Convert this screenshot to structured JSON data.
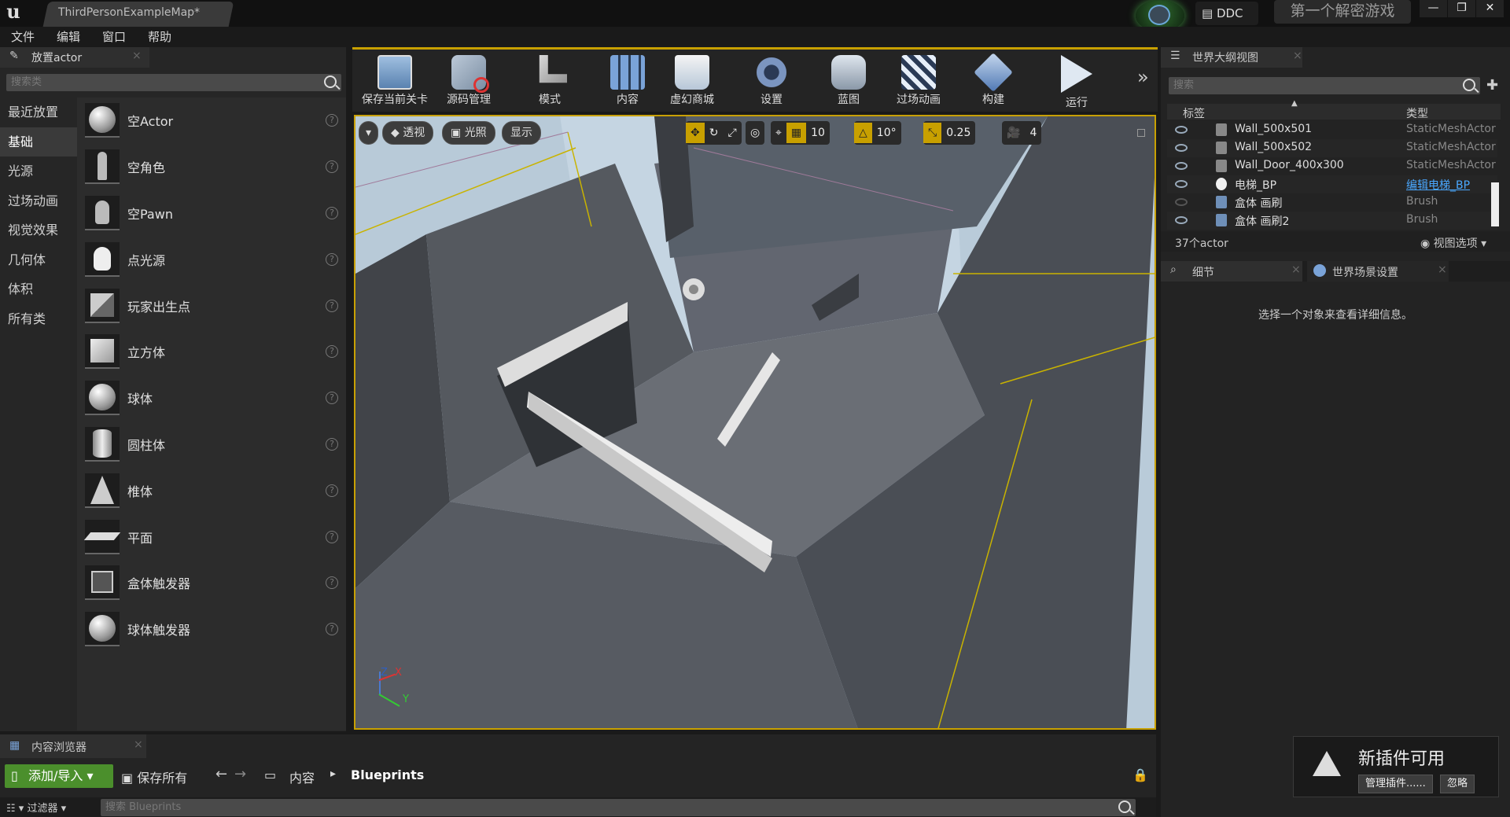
{
  "titlebar": {
    "doc_tab": "ThirdPersonExampleMap*",
    "ddc": "DDC",
    "project_name": "第一个解密游戏",
    "win_minimize": "—",
    "win_restore": "❐",
    "win_close": "✕"
  },
  "menu": [
    "文件",
    "编辑",
    "窗口",
    "帮助"
  ],
  "place_panel": {
    "tab_label": "放置actor",
    "search_placeholder": "搜索类",
    "categories": [
      "最近放置",
      "基础",
      "光源",
      "过场动画",
      "视觉效果",
      "几何体",
      "体积",
      "所有类"
    ],
    "active_category": "基础",
    "items": [
      {
        "label": "空Actor",
        "icon": "empty-actor-icon"
      },
      {
        "label": "空角色",
        "icon": "character-icon"
      },
      {
        "label": "空Pawn",
        "icon": "pawn-icon"
      },
      {
        "label": "点光源",
        "icon": "point-light-icon"
      },
      {
        "label": "玩家出生点",
        "icon": "player-start-icon"
      },
      {
        "label": "立方体",
        "icon": "cube-icon"
      },
      {
        "label": "球体",
        "icon": "sphere-icon"
      },
      {
        "label": "圆柱体",
        "icon": "cylinder-icon"
      },
      {
        "label": "椎体",
        "icon": "cone-icon"
      },
      {
        "label": "平面",
        "icon": "plane-icon"
      },
      {
        "label": "盒体触发器",
        "icon": "box-trigger-icon"
      },
      {
        "label": "球体触发器",
        "icon": "sphere-trigger-icon"
      }
    ]
  },
  "toolbar": {
    "buttons": [
      {
        "label": "保存当前关卡",
        "icon": "save-icon"
      },
      {
        "label": "源码管理",
        "icon": "source-control-icon"
      },
      {
        "label": "模式",
        "icon": "modes-icon"
      },
      {
        "label": "内容",
        "icon": "content-icon"
      },
      {
        "label": "虚幻商城",
        "icon": "marketplace-icon"
      },
      {
        "label": "设置",
        "icon": "settings-icon"
      },
      {
        "label": "蓝图",
        "icon": "blueprints-icon"
      },
      {
        "label": "过场动画",
        "icon": "cinematics-icon"
      },
      {
        "label": "构建",
        "icon": "build-icon"
      },
      {
        "label": "运行",
        "icon": "play-icon"
      }
    ],
    "more": "»"
  },
  "viewport": {
    "perspective": "透视",
    "lighting": "光照",
    "show": "显示",
    "grid_snap": "10",
    "rot_snap": "10°",
    "scale_snap": "0.25",
    "camera_speed": "4",
    "axis_z": "Z",
    "axis_x": "X",
    "axis_y": "Y"
  },
  "outliner": {
    "tab_label": "世界大纲视图",
    "search_placeholder": "搜索",
    "col_label": "标签",
    "col_type": "类型",
    "rows": [
      {
        "name": "Wall_500x501",
        "type": "StaticMeshActor",
        "link": false
      },
      {
        "name": "Wall_500x502",
        "type": "StaticMeshActor",
        "link": false
      },
      {
        "name": "Wall_Door_400x300",
        "type": "StaticMeshActor",
        "link": false
      },
      {
        "name": "电梯_BP",
        "type": "编辑电梯_BP",
        "link": true
      },
      {
        "name": "盒体 画刷",
        "type": "Brush",
        "link": false
      },
      {
        "name": "盒体 画刷2",
        "type": "Brush",
        "link": false
      }
    ],
    "actor_count": "37个actor",
    "view_options": "视图选项"
  },
  "details": {
    "tab_details": "细节",
    "tab_world": "世界场景设置",
    "empty_msg": "选择一个对象来查看详细信息。"
  },
  "content_browser": {
    "tab_label": "内容浏览器",
    "add_import": "添加/导入",
    "save_all": "保存所有",
    "path_root": "内容",
    "path_current": "Blueprints",
    "filters": "过滤器",
    "search_placeholder": "搜索 Blueprints"
  },
  "notification": {
    "title": "新插件可用",
    "manage": "管理插件......",
    "dismiss": "忽略"
  },
  "colors": {
    "accent": "#c8a000",
    "link": "#4aa8ff",
    "add_button": "#4b8f2c"
  }
}
